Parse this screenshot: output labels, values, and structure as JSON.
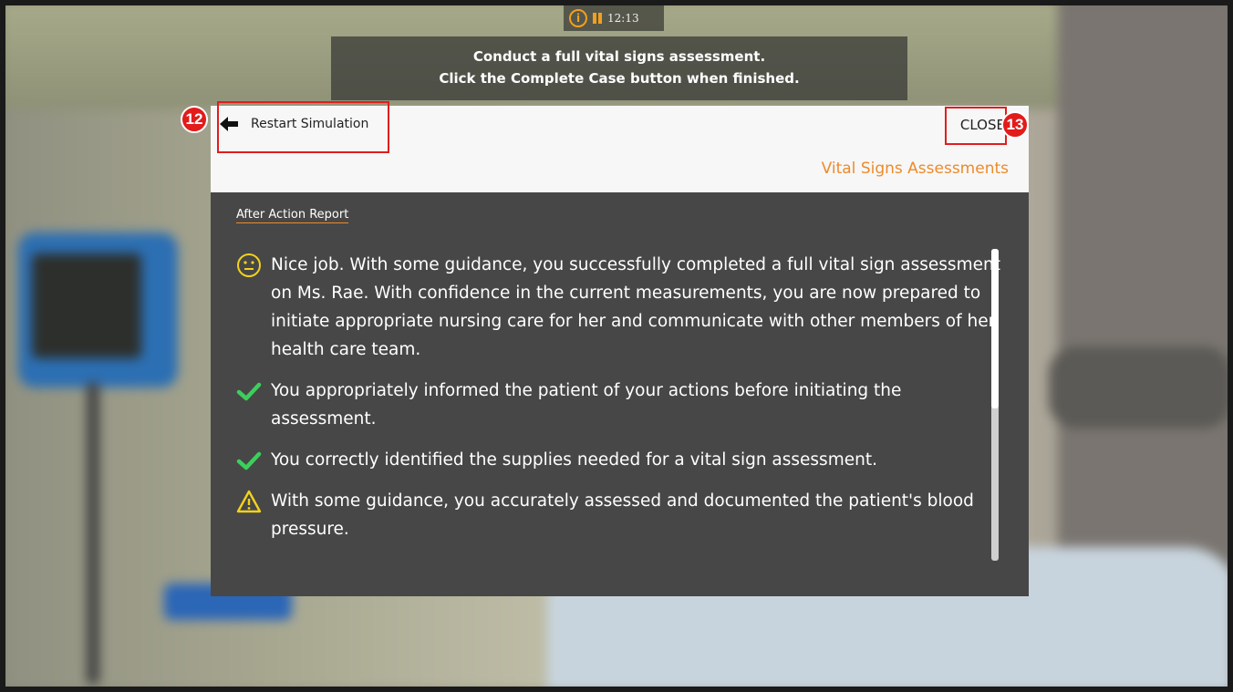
{
  "hud": {
    "timer": "12:13"
  },
  "instruction": {
    "line1": "Conduct a full vital signs assessment.",
    "line2": "Click the Complete Case button when finished."
  },
  "header": {
    "restart_label": "Restart Simulation",
    "close_label": "CLOSE",
    "section_title": "Vital Signs Assessments"
  },
  "report": {
    "title": "After Action Report",
    "items": [
      {
        "icon": "neutral-face-icon",
        "text": "Nice job. With some guidance, you successfully completed a full vital sign assessment on Ms. Rae. With confidence in the current measurements, you are now prepared to initiate appropriate nursing care for her and communicate with other members of her health care team."
      },
      {
        "icon": "checkmark-icon",
        "text": "You appropriately informed the patient of your actions before initiating the assessment."
      },
      {
        "icon": "checkmark-icon",
        "text": "You correctly identified the supplies needed for a vital sign assessment."
      },
      {
        "icon": "warning-icon",
        "text": "With some guidance, you accurately assessed and documented the patient's blood pressure."
      }
    ]
  },
  "callouts": {
    "restart": "12",
    "close": "13"
  },
  "colors": {
    "accent": "#ee8a2a",
    "check": "#3ccf5a",
    "warning": "#f2d21a",
    "callout": "#e01e1e"
  }
}
